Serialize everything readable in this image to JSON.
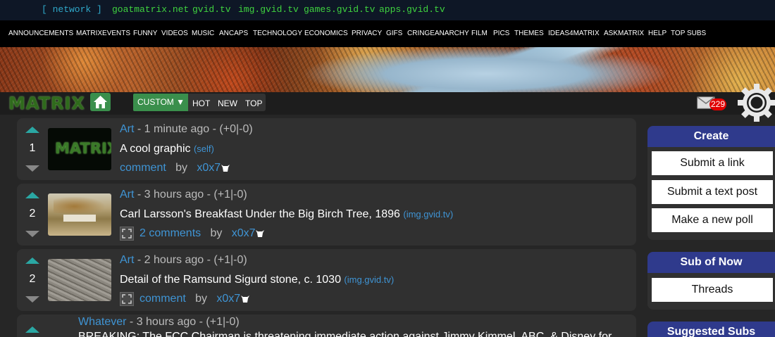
{
  "network": {
    "label": "[ network ]",
    "links": [
      "goatmatrix.net",
      "gvid.tv",
      "img.gvid.tv",
      "games.gvid.tv",
      "apps.gvid.tv"
    ]
  },
  "subs": [
    "ANNOUNCEMENTS",
    "MATRIXEVENTS",
    "FUNNY",
    "VIDEOS",
    "MUSIC",
    "ANCAPS",
    "TECHNOLOGY",
    "ECONOMICS",
    "PRIVACY",
    "GIFS",
    "CRINGEANARCHY",
    "FILM",
    "PICS",
    "THEMES",
    "IDEAS4MATRIX",
    "ASKMATRIX",
    "HELP",
    "TOP SUBS"
  ],
  "nav": {
    "logo": "MATRIX",
    "sort_custom": "CUSTOM ▼",
    "sort_hot": "HOT",
    "sort_new": "NEW",
    "sort_top": "TOP",
    "mail_count": "229"
  },
  "posts": [
    {
      "score": "1",
      "sub": "Art",
      "meta": " - 1 minute ago - (+0|-0)",
      "title": "A cool graphic",
      "domain": "(self)",
      "comments": "comment",
      "by": "by",
      "author": "x0x7",
      "thumb_text": "MATRIX"
    },
    {
      "score": "2",
      "sub": "Art",
      "meta": " - 3 hours ago - (+1|-0)",
      "title": "Carl Larsson's Breakfast Under the Big Birch Tree, 1896",
      "domain": "(img.gvid.tv)",
      "comments": "2 comments",
      "by": "by",
      "author": "x0x7"
    },
    {
      "score": "2",
      "sub": "Art",
      "meta": " - 2 hours ago - (+1|-0)",
      "title": "Detail of the Ramsund Sigurd stone, c. 1030",
      "domain": "(img.gvid.tv)",
      "comments": "comment",
      "by": "by",
      "author": "x0x7"
    },
    {
      "sub": "Whatever",
      "meta": " - 3 hours ago - (+1|-0)",
      "title": "BREAKING: The FCC Chairman is threatening immediate action against Jimmy Kimmel, ABC, & Disney for"
    }
  ],
  "sidebar": {
    "create": {
      "header": "Create",
      "buttons": [
        "Submit a link",
        "Submit a text post",
        "Make a new poll"
      ]
    },
    "sub_of_now": {
      "header": "Sub of Now",
      "buttons": [
        "Threads"
      ]
    },
    "suggested": {
      "header": "Suggested Subs"
    }
  },
  "colors": {
    "accent_green": "#3a8f4c",
    "link_blue": "#3f94d4",
    "sidebar_header": "#2f3a8c",
    "upvote": "#2aa7a3",
    "badge_red": "#e00000"
  }
}
